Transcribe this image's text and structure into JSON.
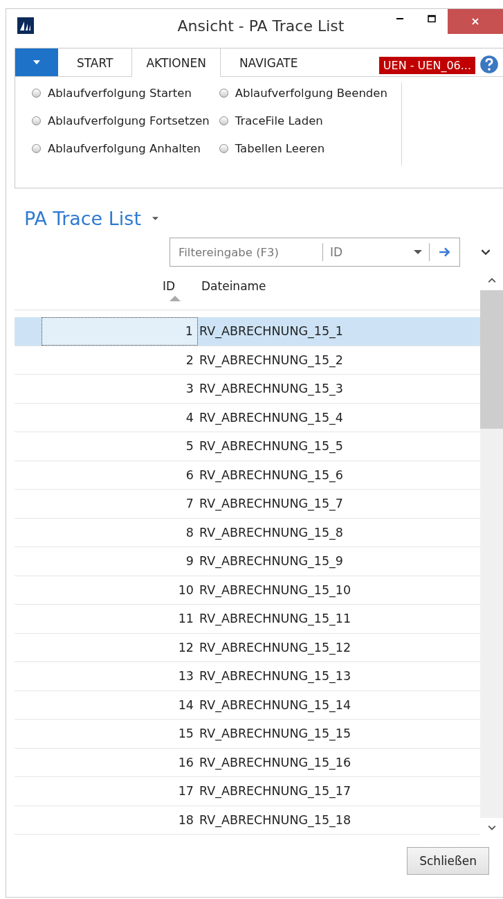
{
  "window": {
    "title": "Ansicht - PA Trace List"
  },
  "tabs": [
    {
      "label": "START",
      "selected": false
    },
    {
      "label": "AKTIONEN",
      "selected": true
    },
    {
      "label": "NAVIGATE",
      "selected": false
    }
  ],
  "company_badge": "UEN - UEN_06...",
  "actions": [
    {
      "label": "Ablaufverfolgung Starten"
    },
    {
      "label": "Ablaufverfolgung Fortsetzen"
    },
    {
      "label": "Ablaufverfolgung Anhalten"
    },
    {
      "label": "Ablaufverfolgung Beenden"
    },
    {
      "label": "TraceFile Laden"
    },
    {
      "label": "Tabellen Leeren"
    }
  ],
  "page_title": "PA Trace List",
  "filter": {
    "placeholder": "Filtereingabe (F3)",
    "field": "ID"
  },
  "table": {
    "columns": [
      {
        "label": "ID",
        "sorted": true
      },
      {
        "label": "Dateiname",
        "sorted": false
      }
    ],
    "rows": [
      {
        "id": "1",
        "name": "RV_ABRECHNUNG_15_1",
        "selected": true
      },
      {
        "id": "2",
        "name": "RV_ABRECHNUNG_15_2",
        "selected": false
      },
      {
        "id": "3",
        "name": "RV_ABRECHNUNG_15_3",
        "selected": false
      },
      {
        "id": "4",
        "name": "RV_ABRECHNUNG_15_4",
        "selected": false
      },
      {
        "id": "5",
        "name": "RV_ABRECHNUNG_15_5",
        "selected": false
      },
      {
        "id": "6",
        "name": "RV_ABRECHNUNG_15_6",
        "selected": false
      },
      {
        "id": "7",
        "name": "RV_ABRECHNUNG_15_7",
        "selected": false
      },
      {
        "id": "8",
        "name": "RV_ABRECHNUNG_15_8",
        "selected": false
      },
      {
        "id": "9",
        "name": "RV_ABRECHNUNG_15_9",
        "selected": false
      },
      {
        "id": "10",
        "name": "RV_ABRECHNUNG_15_10",
        "selected": false
      },
      {
        "id": "11",
        "name": "RV_ABRECHNUNG_15_11",
        "selected": false
      },
      {
        "id": "12",
        "name": "RV_ABRECHNUNG_15_12",
        "selected": false
      },
      {
        "id": "13",
        "name": "RV_ABRECHNUNG_15_13",
        "selected": false
      },
      {
        "id": "14",
        "name": "RV_ABRECHNUNG_15_14",
        "selected": false
      },
      {
        "id": "15",
        "name": "RV_ABRECHNUNG_15_15",
        "selected": false
      },
      {
        "id": "16",
        "name": "RV_ABRECHNUNG_15_16",
        "selected": false
      },
      {
        "id": "17",
        "name": "RV_ABRECHNUNG_15_17",
        "selected": false
      },
      {
        "id": "18",
        "name": "RV_ABRECHNUNG_15_18",
        "selected": false
      }
    ]
  },
  "buttons": [
    "Schließen"
  ]
}
